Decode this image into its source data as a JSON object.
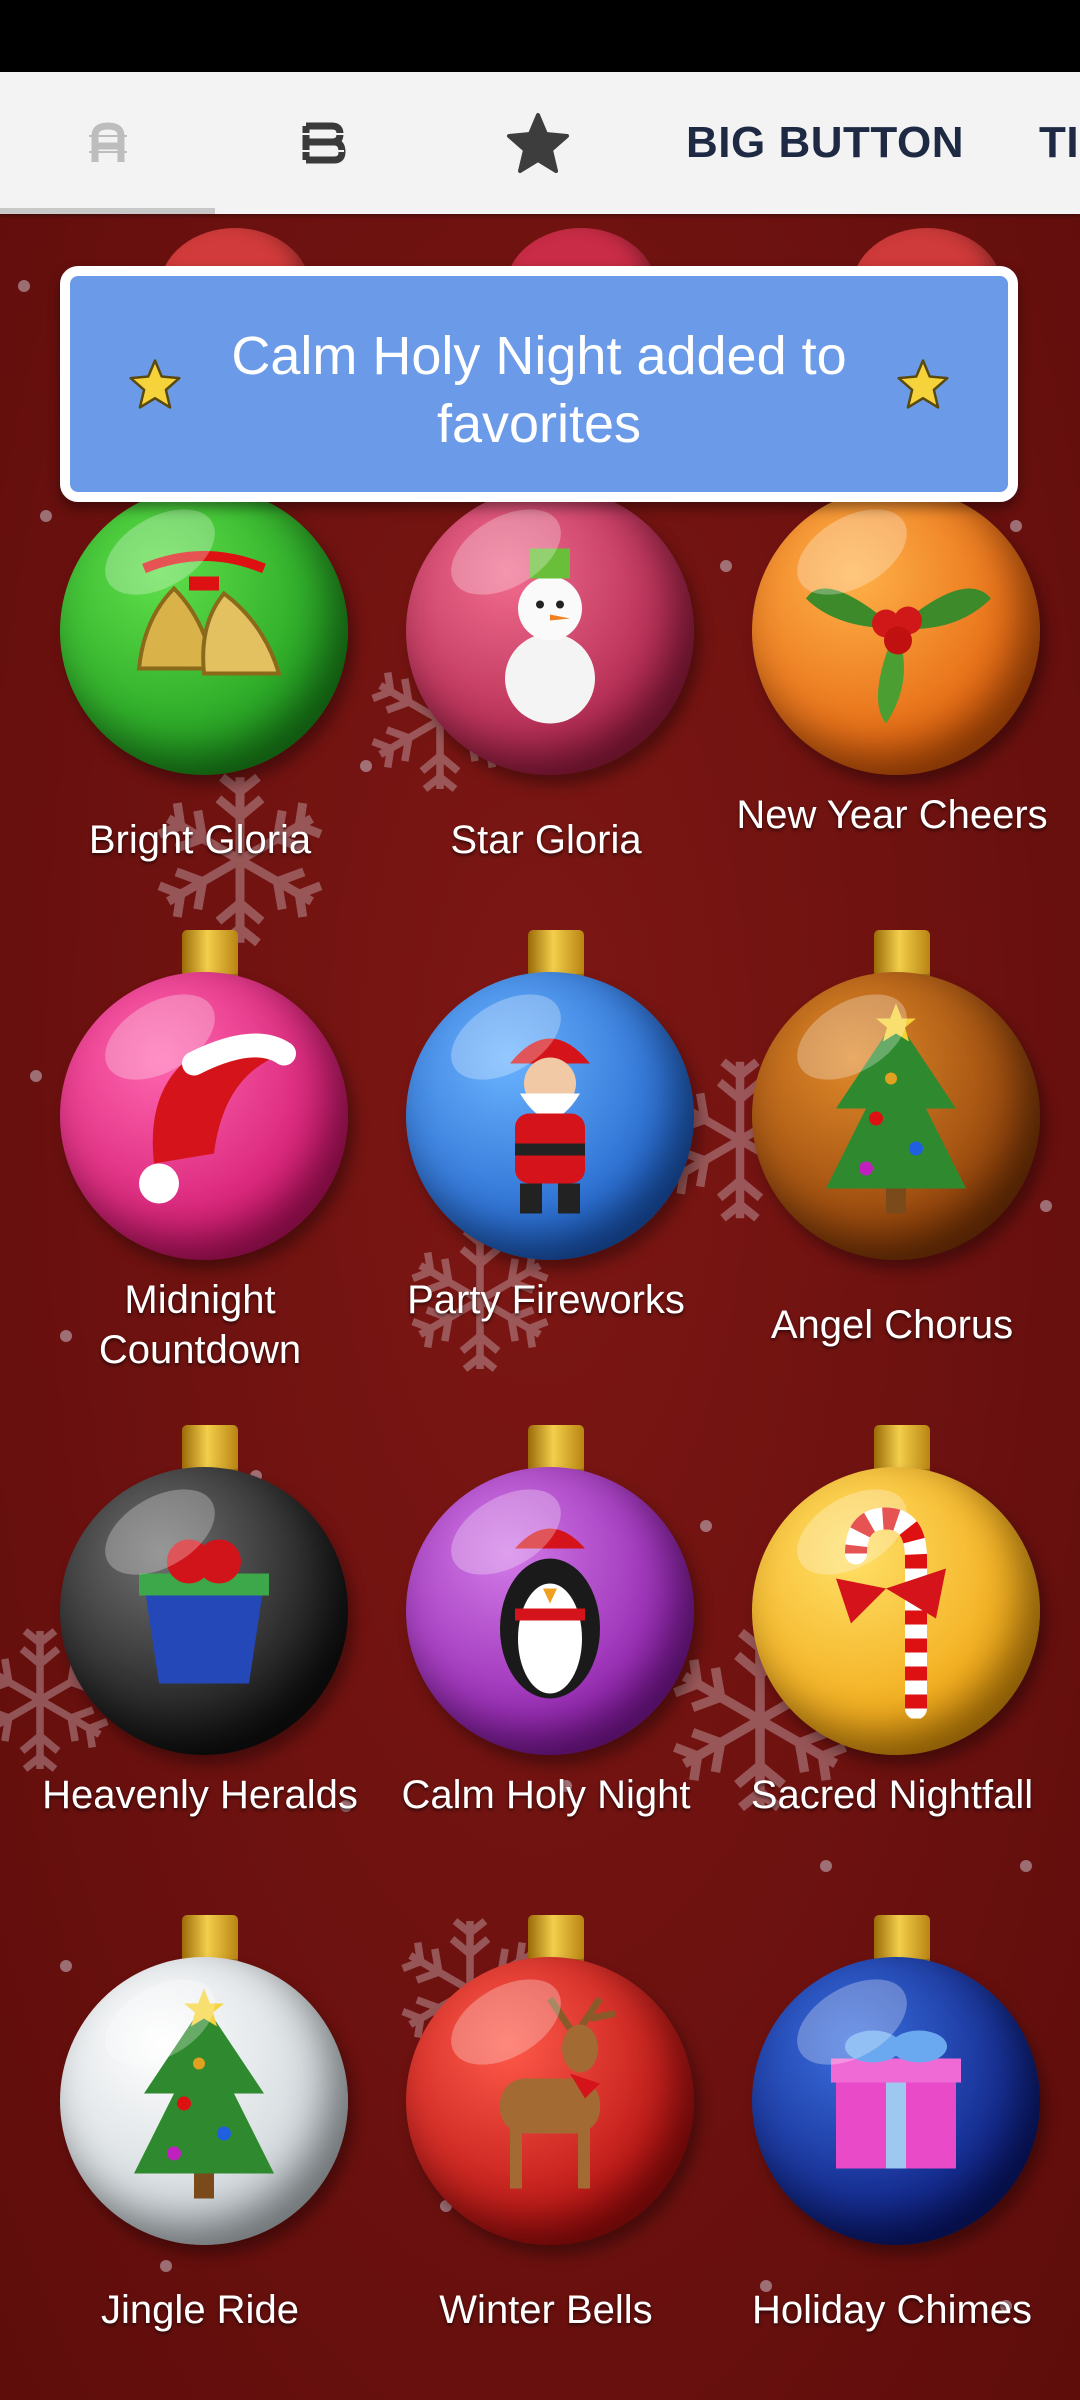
{
  "tabs": {
    "tab_a_icon": "letter-a-icon",
    "tab_b_icon": "letter-b-icon",
    "favorites_icon": "star-icon",
    "big_button": "BIG BUTTON",
    "next_partial": "TI"
  },
  "toast": {
    "message": "Calm Holy Night added to favorites",
    "icon": "star-icon"
  },
  "colors": {
    "background": "#6e1210",
    "toast": "#6b9be8",
    "tab_bar": "#f3f3f3"
  },
  "ornaments": [
    {
      "label": "Bright Gloria",
      "color": "green",
      "icon": "bells-icon"
    },
    {
      "label": "Star Gloria",
      "color": "pink",
      "icon": "snowman-icon"
    },
    {
      "label": "New Year Cheers",
      "color": "orange",
      "icon": "holly-icon"
    },
    {
      "label": "Midnight Countdown",
      "color": "magenta",
      "icon": "santa-hat-icon"
    },
    {
      "label": "Party Fireworks",
      "color": "blue",
      "icon": "santa-icon"
    },
    {
      "label": "Angel Chorus",
      "color": "amber",
      "icon": "christmas-tree-icon"
    },
    {
      "label": "Heavenly Heralds",
      "color": "black",
      "icon": "gift-basket-icon"
    },
    {
      "label": "Calm Holy Night",
      "color": "purple",
      "icon": "penguin-icon"
    },
    {
      "label": "Sacred Nightfall",
      "color": "yellow",
      "icon": "candy-cane-icon"
    },
    {
      "label": "Jingle Ride",
      "color": "white",
      "icon": "christmas-tree-icon"
    },
    {
      "label": "Winter Bells",
      "color": "red",
      "icon": "reindeer-icon"
    },
    {
      "label": "Holiday Chimes",
      "color": "navy",
      "icon": "gift-box-icon"
    }
  ]
}
